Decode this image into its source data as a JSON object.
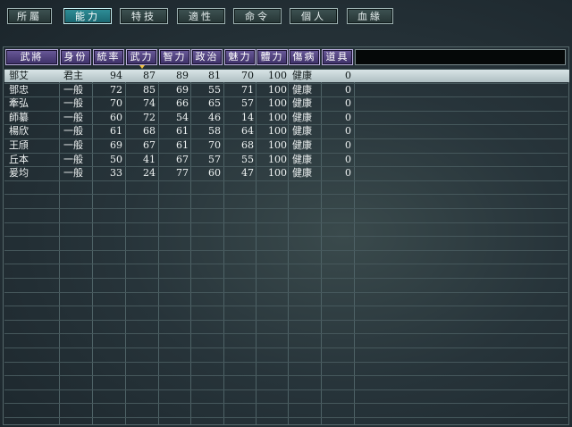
{
  "tabs": [
    {
      "label": "所屬",
      "active": false
    },
    {
      "label": "能力",
      "active": true
    },
    {
      "label": "特技",
      "active": false
    },
    {
      "label": "適性",
      "active": false
    },
    {
      "label": "命令",
      "active": false
    },
    {
      "label": "個人",
      "active": false
    },
    {
      "label": "血緣",
      "active": false
    }
  ],
  "table": {
    "headers": [
      "武將",
      "身份",
      "統率",
      "武力",
      "智力",
      "政治",
      "魅力",
      "體力",
      "傷病",
      "道具"
    ],
    "sorted_column": "武力",
    "rows": [
      {
        "name": "鄧艾",
        "rank": "君主",
        "lead": "94",
        "war": "87",
        "int": "89",
        "pol": "81",
        "chr": "70",
        "hp": "100",
        "health": "健康",
        "items": "0",
        "selected": true
      },
      {
        "name": "鄧忠",
        "rank": "一般",
        "lead": "72",
        "war": "85",
        "int": "69",
        "pol": "55",
        "chr": "71",
        "hp": "100",
        "health": "健康",
        "items": "0",
        "selected": false
      },
      {
        "name": "牽弘",
        "rank": "一般",
        "lead": "70",
        "war": "74",
        "int": "66",
        "pol": "65",
        "chr": "57",
        "hp": "100",
        "health": "健康",
        "items": "0",
        "selected": false
      },
      {
        "name": "師纂",
        "rank": "一般",
        "lead": "60",
        "war": "72",
        "int": "54",
        "pol": "46",
        "chr": "14",
        "hp": "100",
        "health": "健康",
        "items": "0",
        "selected": false
      },
      {
        "name": "楊欣",
        "rank": "一般",
        "lead": "61",
        "war": "68",
        "int": "61",
        "pol": "58",
        "chr": "64",
        "hp": "100",
        "health": "健康",
        "items": "0",
        "selected": false
      },
      {
        "name": "王頎",
        "rank": "一般",
        "lead": "69",
        "war": "67",
        "int": "61",
        "pol": "70",
        "chr": "68",
        "hp": "100",
        "health": "健康",
        "items": "0",
        "selected": false
      },
      {
        "name": "丘本",
        "rank": "一般",
        "lead": "50",
        "war": "41",
        "int": "67",
        "pol": "57",
        "chr": "55",
        "hp": "100",
        "health": "健康",
        "items": "0",
        "selected": false
      },
      {
        "name": "爰均",
        "rank": "一般",
        "lead": "33",
        "war": "24",
        "int": "77",
        "pol": "60",
        "chr": "47",
        "hp": "100",
        "health": "健康",
        "items": "0",
        "selected": false
      }
    ]
  },
  "colors": {
    "active_tab": "#1f7c85",
    "header_button": "#4a3c7a",
    "selected_row": "#c6d4d6"
  }
}
